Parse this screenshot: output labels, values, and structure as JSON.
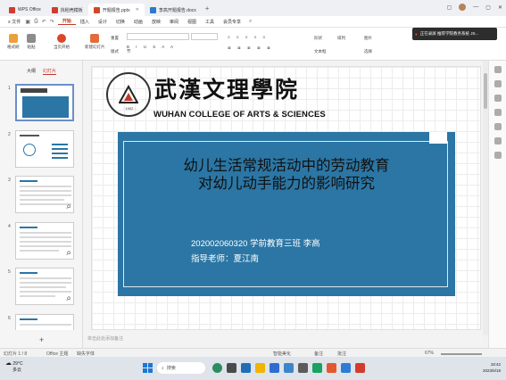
{
  "window": {
    "tabs": [
      {
        "label": "WPS Office",
        "color": "#d33b2c"
      },
      {
        "label": "找稻壳模板",
        "color": "#d33b2c"
      },
      {
        "label": "开题报告.pptx",
        "color": "#d24726"
      },
      {
        "label": "李高开题报告.docx",
        "color": "#2b79d0"
      }
    ],
    "add_tab": "+"
  },
  "menu": {
    "file_label": "≡ 文件",
    "items": [
      "开始",
      "插入",
      "设计",
      "切换",
      "动画",
      "放映",
      "审阅",
      "视图",
      "工具",
      "会员专享"
    ],
    "active": "开始"
  },
  "ribbon": {
    "format_painter": "格式刷",
    "paste": "粘贴",
    "from_current": "当页开始",
    "new_slide": "新建幻灯片",
    "layout": "版式",
    "section": "节",
    "reset": "重置",
    "picture": "图片",
    "textbox": "文本框",
    "shape": "形状",
    "arrange": "排列",
    "select": "选择"
  },
  "toast": {
    "text": "正在录屏  推荐学院教务系统  JS..."
  },
  "panel": {
    "tab_outline": "大纲",
    "tab_slides": "幻灯片",
    "slide_numbers": [
      "1",
      "2",
      "3",
      "4",
      "5",
      "6"
    ],
    "add_button": "+"
  },
  "slide": {
    "college_cn": "武漢文理學院",
    "college_en": "WUHAN COLLEGE OF ARTS & SCIENCES",
    "seal_year": "· 1902 ·",
    "title_line1": "幼儿生活常规活动中的劳动教育",
    "title_line2": "对幼儿动手能力的影响研究",
    "student_info": "202002060320   学前教育三班   李高",
    "advisor": "指导老师：夏江南",
    "box_color": "#2b76a4"
  },
  "notes_placeholder": "单击此处添加备注",
  "status": {
    "slide_count": "幻灯片 1 / 8",
    "theme": "Office 主题",
    "missing_font": "缺失字体",
    "smart": "智能美化",
    "notes": "备注",
    "comment": "批注",
    "zoom": "67%"
  },
  "taskbar": {
    "temp": "29°C",
    "weather": "多云",
    "search": "搜索",
    "time": "18:42",
    "date": "2023/6/19"
  }
}
